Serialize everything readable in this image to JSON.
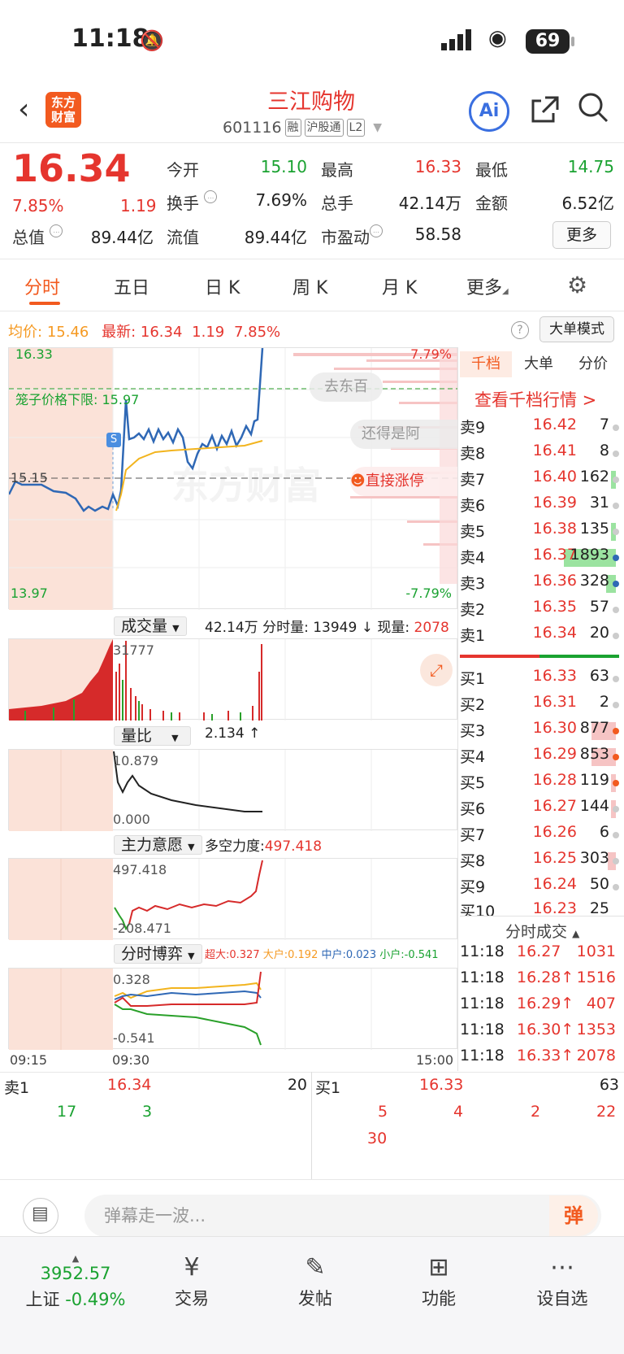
{
  "status": {
    "time": "11:18",
    "battery": "69"
  },
  "header": {
    "logo": "东方\n财富",
    "title": "三江购物",
    "code": "601116",
    "tags": [
      "融",
      "沪股通",
      "L2"
    ],
    "ai_label": "Ai"
  },
  "quote": {
    "price": "16.34",
    "change_pct": "7.85%",
    "change": "1.19",
    "fields": [
      {
        "label": "今开",
        "value": "15.10",
        "color": "green"
      },
      {
        "label": "最高",
        "value": "16.33",
        "color": "red"
      },
      {
        "label": "最低",
        "value": "14.75",
        "color": "green"
      },
      {
        "label": "换手",
        "value": "7.69%",
        "color": "dark"
      },
      {
        "label": "总手",
        "value": "42.14万",
        "color": "dark"
      },
      {
        "label": "金额",
        "value": "6.52亿",
        "color": "dark"
      },
      {
        "label": "总值",
        "value": "89.44亿",
        "color": "dark"
      },
      {
        "label": "流值",
        "value": "89.44亿",
        "color": "dark"
      },
      {
        "label": "市盈动",
        "value": "58.58",
        "color": "dark"
      }
    ],
    "more": "更多"
  },
  "tabs": [
    "分时",
    "五日",
    "日 K",
    "周 K",
    "月 K",
    "更多"
  ],
  "chart_header": {
    "avg_label": "均价:",
    "avg": "15.46",
    "latest_label": "最新:",
    "latest": "16.34",
    "chg": "1.19",
    "pct": "7.85%",
    "big_order": "大单模式"
  },
  "main_chart": {
    "top_price": "16.33",
    "bottom_price": "13.97",
    "top_pct": "7.79%",
    "bottom_pct": "-7.79%",
    "ref_price": "15.15",
    "cage_label": "笼子价格下限:",
    "cage_value": "15.97",
    "watermark": "东方财富",
    "danmu": [
      "去东百",
      "还得是阿",
      "直接涨停"
    ],
    "s_marker": "S"
  },
  "volume": {
    "label": "成交量",
    "total": "42.14万",
    "minute_label": "分时量:",
    "minute_value": "13949",
    "now_label": "现量:",
    "now_value": "2078",
    "peak": "31777"
  },
  "ratio": {
    "label": "量比",
    "value": "2.134",
    "max": "10.879",
    "min": "0.000"
  },
  "main_force": {
    "label": "主力意愿",
    "strength_label": "多空力度:",
    "strength": "497.418",
    "max": "497.418",
    "min": "-208.471"
  },
  "game": {
    "label": "分时博弈",
    "super": "超大:0.327",
    "big": "大户:0.192",
    "mid": "中户:0.023",
    "small": "小户:-0.541",
    "max": "0.328",
    "min": "-0.541"
  },
  "time_axis": [
    "09:15",
    "09:30",
    "15:00"
  ],
  "orderbook": {
    "tabs": [
      "千档",
      "大单",
      "分价"
    ],
    "link": "查看千档行情 >",
    "asks": [
      {
        "n": "卖9",
        "p": "16.42",
        "v": "7"
      },
      {
        "n": "卖8",
        "p": "16.41",
        "v": "8"
      },
      {
        "n": "卖7",
        "p": "16.40",
        "v": "162"
      },
      {
        "n": "卖6",
        "p": "16.39",
        "v": "31"
      },
      {
        "n": "卖5",
        "p": "16.38",
        "v": "135"
      },
      {
        "n": "卖4",
        "p": "16.37",
        "v": "1893"
      },
      {
        "n": "卖3",
        "p": "16.36",
        "v": "328"
      },
      {
        "n": "卖2",
        "p": "16.35",
        "v": "57"
      },
      {
        "n": "卖1",
        "p": "16.34",
        "v": "20"
      }
    ],
    "bids": [
      {
        "n": "买1",
        "p": "16.33",
        "v": "63"
      },
      {
        "n": "买2",
        "p": "16.31",
        "v": "2"
      },
      {
        "n": "买3",
        "p": "16.30",
        "v": "877"
      },
      {
        "n": "买4",
        "p": "16.29",
        "v": "853"
      },
      {
        "n": "买5",
        "p": "16.28",
        "v": "119"
      },
      {
        "n": "买6",
        "p": "16.27",
        "v": "144"
      },
      {
        "n": "买7",
        "p": "16.26",
        "v": "6"
      },
      {
        "n": "买8",
        "p": "16.25",
        "v": "303"
      },
      {
        "n": "买9",
        "p": "16.24",
        "v": "50"
      },
      {
        "n": "买10",
        "p": "16.23",
        "v": "25"
      }
    ]
  },
  "ticks": {
    "label": "分时成交",
    "rows": [
      {
        "t": "11:18",
        "p": "16.27",
        "v": "1031"
      },
      {
        "t": "11:18",
        "p": "16.28↑",
        "v": "1516"
      },
      {
        "t": "11:18",
        "p": "16.29↑",
        "v": "407"
      },
      {
        "t": "11:18",
        "p": "16.30↑",
        "v": "1353"
      },
      {
        "t": "11:18",
        "p": "16.33↑",
        "v": "2078"
      }
    ]
  },
  "queue": {
    "sell_label": "卖1",
    "sell_price": "16.34",
    "sell_vol": "20",
    "sell_orders": [
      "17",
      "3"
    ],
    "buy_label": "买1",
    "buy_price": "16.33",
    "buy_vol": "63",
    "buy_orders": [
      "5",
      "4",
      "2",
      "22",
      "30"
    ]
  },
  "danmu_bar": {
    "placeholder": "弹幕走一波...",
    "button": "弹"
  },
  "bottom_nav": {
    "index_value": "3952.57",
    "index_name": "上证",
    "index_pct": "-0.49%",
    "items": [
      "交易",
      "发帖",
      "功能",
      "设自选"
    ]
  }
}
